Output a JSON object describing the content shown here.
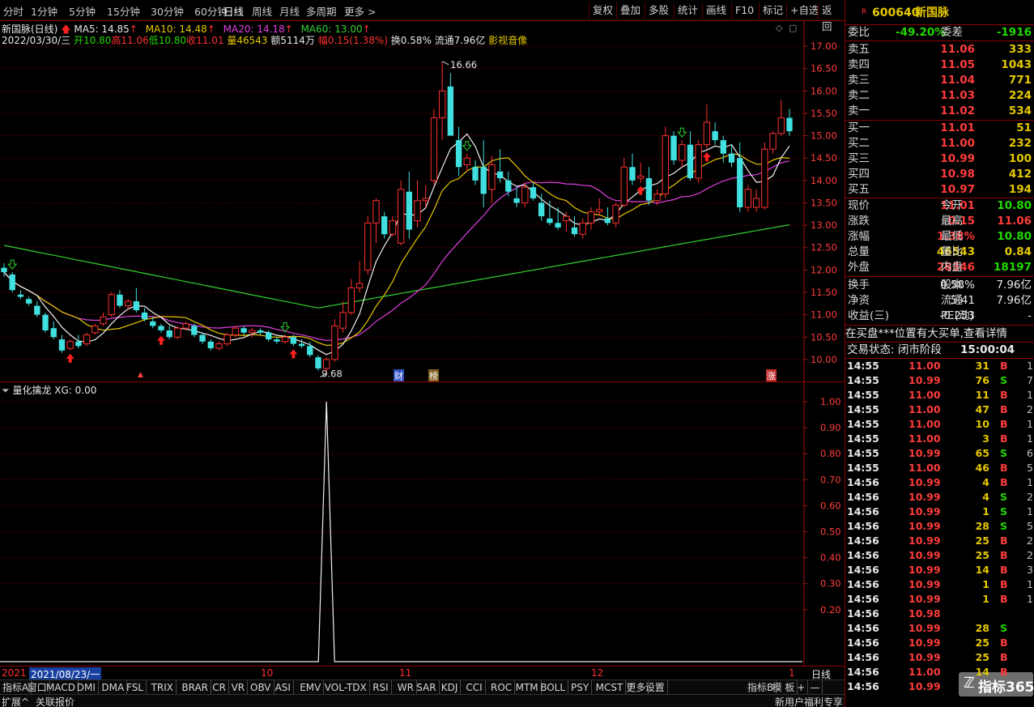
{
  "toolbar": {
    "periods": [
      "分时",
      "1分钟",
      "5分钟",
      "15分钟",
      "30分钟",
      "60分钟",
      "日线",
      "周线",
      "月线",
      "多周期",
      "更多"
    ],
    "more_arrow": ">",
    "actions": [
      "复权",
      "叠加",
      "多股",
      "统计",
      "画线",
      "F10",
      "标记",
      "+自选",
      "返回"
    ]
  },
  "info": {
    "title": "新国脉(日线)",
    "ma5": "MA5: 14.85",
    "ma10": "MA10: 14.48",
    "ma20": "MA20: 14.18",
    "ma60": "MA60: 13.00",
    "ma_arrow": "↑",
    "date": "2022/03/30/三",
    "open": "开10.80",
    "high": "高11.06",
    "low": "低10.80",
    "close": "收11.01",
    "volume": "量46543",
    "amount": "额5114万",
    "amp": "幅0.15(1.38%)",
    "turnover": "换0.58%",
    "float": "流通7.96亿",
    "sector": "影视音像"
  },
  "annotations": {
    "high_label": "16.66",
    "low_label": "9.68",
    "marker_cai": "财",
    "marker_bang": "榜",
    "marker_zhang": "涨"
  },
  "indicator": {
    "title": "量化擒龙 XG: 0.00"
  },
  "xaxis": {
    "start_label": "2021/08/23/一",
    "start_short": "2021",
    "labels": [
      "10",
      "11",
      "12",
      "1"
    ],
    "view": "日线"
  },
  "bottom_tabs": [
    "指标A",
    "窗口",
    "MACD",
    "DMI",
    "DMA",
    "FSL",
    "TRIX",
    "BRAR",
    "CR",
    "VR",
    "OBV",
    "ASI",
    "EMV",
    "VOL-TDX",
    "RSI",
    "WR",
    "SAR",
    "KDJ",
    "CCI",
    "ROC",
    "MTM",
    "BOLL",
    "PSY",
    "MCST",
    "更多",
    "设置",
    "指标B",
    "模 板",
    "+",
    "—"
  ],
  "status": {
    "expand": "扩展^",
    "report": "关联报价",
    "promo": "新用户福利专享"
  },
  "panel": {
    "r_badge": "R",
    "code": "600640",
    "name": "新国脉",
    "weibi_label": "委比",
    "weibi_value": "-49.20%",
    "weicha_label": "委差",
    "weicha_value": "-1916",
    "asks": [
      {
        "label": "卖五",
        "price": "11.06",
        "vol": "333"
      },
      {
        "label": "卖四",
        "price": "11.05",
        "vol": "1043"
      },
      {
        "label": "卖三",
        "price": "11.04",
        "vol": "771"
      },
      {
        "label": "卖二",
        "price": "11.03",
        "vol": "224"
      },
      {
        "label": "卖一",
        "price": "11.02",
        "vol": "534"
      }
    ],
    "bids": [
      {
        "label": "买一",
        "price": "11.01",
        "vol": "51"
      },
      {
        "label": "买二",
        "price": "11.00",
        "vol": "232"
      },
      {
        "label": "买三",
        "price": "10.99",
        "vol": "100"
      },
      {
        "label": "买四",
        "price": "10.98",
        "vol": "412"
      },
      {
        "label": "买五",
        "price": "10.97",
        "vol": "194"
      }
    ],
    "quote": [
      {
        "l1": "现价",
        "v1": "11.01",
        "c1": "red",
        "l2": "今开",
        "v2": "10.80",
        "c2": "green"
      },
      {
        "l1": "涨跌",
        "v1": "0.15",
        "c1": "red",
        "l2": "最高",
        "v2": "11.06",
        "c2": "red"
      },
      {
        "l1": "涨幅",
        "v1": "1.38%",
        "c1": "red",
        "l2": "最低",
        "v2": "10.80",
        "c2": "green"
      },
      {
        "l1": "总量",
        "v1": "46543",
        "c1": "yellow",
        "l2": "量比",
        "v2": "0.84",
        "c2": "yellow"
      },
      {
        "l1": "外盘",
        "v1": "28346",
        "c1": "red",
        "l2": "内盘",
        "v2": "18197",
        "c2": "green"
      }
    ],
    "fin": [
      {
        "l1": "换手",
        "v1": "0.58%",
        "l2": "股本",
        "v2": "7.96亿"
      },
      {
        "l1": "净资",
        "v1": "5.41",
        "l2": "流通",
        "v2": "7.96亿"
      },
      {
        "l1": "收益(三)",
        "v1": "-0.253",
        "l2": "PE(动)",
        "v2": "-"
      }
    ],
    "message": "在买盘***位置有大买单,查看详情",
    "trade_state": "交易状态: 闭市阶段",
    "trade_time": "15:00:04",
    "trades": [
      {
        "t": "14:55",
        "p": "11.00",
        "v": "31",
        "s": "B",
        "n": "1"
      },
      {
        "t": "14:55",
        "p": "10.99",
        "v": "76",
        "s": "S",
        "n": "7"
      },
      {
        "t": "14:55",
        "p": "11.00",
        "v": "11",
        "s": "B",
        "n": "1"
      },
      {
        "t": "14:55",
        "p": "11.00",
        "v": "47",
        "s": "B",
        "n": "2"
      },
      {
        "t": "14:55",
        "p": "11.00",
        "v": "10",
        "s": "B",
        "n": "1"
      },
      {
        "t": "14:55",
        "p": "11.00",
        "v": "3",
        "s": "B",
        "n": "1"
      },
      {
        "t": "14:55",
        "p": "10.99",
        "v": "65",
        "s": "S",
        "n": "6"
      },
      {
        "t": "14:55",
        "p": "11.00",
        "v": "46",
        "s": "B",
        "n": "5"
      },
      {
        "t": "14:56",
        "p": "10.99",
        "v": "4",
        "s": "B",
        "n": "1"
      },
      {
        "t": "14:56",
        "p": "10.99",
        "v": "4",
        "s": "S",
        "n": "2"
      },
      {
        "t": "14:56",
        "p": "10.99",
        "v": "1",
        "s": "S",
        "n": "1"
      },
      {
        "t": "14:56",
        "p": "10.99",
        "v": "28",
        "s": "S",
        "n": "5"
      },
      {
        "t": "14:56",
        "p": "10.99",
        "v": "25",
        "s": "B",
        "n": "2"
      },
      {
        "t": "14:56",
        "p": "10.99",
        "v": "25",
        "s": "B",
        "n": "2"
      },
      {
        "t": "14:56",
        "p": "10.99",
        "v": "14",
        "s": "B",
        "n": "3"
      },
      {
        "t": "14:56",
        "p": "10.99",
        "v": "1",
        "s": "B",
        "n": "1"
      },
      {
        "t": "14:56",
        "p": "10.99",
        "v": "1",
        "s": "B",
        "n": "1"
      },
      {
        "t": "14:56",
        "p": "10.98",
        "v": "",
        "s": "",
        "n": ""
      },
      {
        "t": "14:56",
        "p": "10.99",
        "v": "28",
        "s": "S",
        "n": ""
      },
      {
        "t": "14:56",
        "p": "10.99",
        "v": "25",
        "s": "B",
        "n": ""
      },
      {
        "t": "14:56",
        "p": "10.99",
        "v": "25",
        "s": "B",
        "n": ""
      },
      {
        "t": "14:56",
        "p": "11.00",
        "v": "14",
        "s": "B",
        "n": ""
      },
      {
        "t": "14:56",
        "p": "10.99",
        "v": "",
        "s": "",
        "n": ""
      },
      {
        "t": "14:56",
        "p": "10.99",
        "v": "",
        "s": "",
        "n": ""
      }
    ],
    "watermark": "指标365"
  },
  "chart_data": [
    {
      "type": "candlestick",
      "title": "新国脉(日线)",
      "ylim": [
        9.6,
        17.2
      ],
      "yticks": [
        10.0,
        10.5,
        11.0,
        11.5,
        12.0,
        12.5,
        13.0,
        13.5,
        14.0,
        14.5,
        15.0,
        15.5,
        16.0,
        16.5,
        17.0
      ],
      "candles": [
        [
          12.05,
          12.15,
          11.85,
          11.95
        ],
        [
          11.9,
          11.95,
          11.5,
          11.55
        ],
        [
          11.45,
          11.55,
          11.35,
          11.4
        ],
        [
          11.35,
          11.4,
          11.2,
          11.25
        ],
        [
          11.2,
          11.3,
          10.95,
          11.0
        ],
        [
          11.0,
          11.05,
          10.6,
          10.65
        ],
        [
          10.7,
          10.85,
          10.45,
          10.5
        ],
        [
          10.45,
          10.55,
          10.15,
          10.2
        ],
        [
          10.25,
          10.45,
          10.2,
          10.4
        ],
        [
          10.4,
          10.55,
          10.25,
          10.3
        ],
        [
          10.35,
          10.6,
          10.3,
          10.55
        ],
        [
          10.6,
          10.8,
          10.55,
          10.75
        ],
        [
          10.8,
          11.05,
          10.75,
          10.95
        ],
        [
          11.0,
          11.5,
          10.95,
          11.45
        ],
        [
          11.45,
          11.55,
          11.15,
          11.2
        ],
        [
          11.2,
          11.35,
          11.1,
          11.3
        ],
        [
          11.3,
          11.6,
          11.05,
          11.1
        ],
        [
          11.05,
          11.15,
          10.85,
          10.9
        ],
        [
          10.85,
          10.95,
          10.7,
          10.75
        ],
        [
          10.75,
          10.8,
          10.6,
          10.65
        ],
        [
          10.65,
          10.75,
          10.45,
          10.5
        ],
        [
          10.5,
          10.75,
          10.45,
          10.7
        ],
        [
          10.7,
          10.85,
          10.65,
          10.8
        ],
        [
          10.75,
          10.8,
          10.5,
          10.55
        ],
        [
          10.55,
          10.6,
          10.35,
          10.4
        ],
        [
          10.4,
          10.45,
          10.2,
          10.25
        ],
        [
          10.25,
          10.4,
          10.2,
          10.35
        ],
        [
          10.35,
          10.6,
          10.3,
          10.55
        ],
        [
          10.55,
          10.75,
          10.5,
          10.7
        ],
        [
          10.7,
          10.75,
          10.55,
          10.6
        ],
        [
          10.6,
          10.7,
          10.5,
          10.65
        ],
        [
          10.65,
          10.7,
          10.55,
          10.6
        ],
        [
          10.6,
          10.65,
          10.4,
          10.45
        ],
        [
          10.45,
          10.5,
          10.35,
          10.4
        ],
        [
          10.4,
          10.55,
          10.35,
          10.5
        ],
        [
          10.5,
          10.55,
          10.3,
          10.35
        ],
        [
          10.35,
          10.45,
          10.25,
          10.3
        ],
        [
          10.3,
          10.4,
          10.05,
          10.1
        ],
        [
          10.05,
          10.1,
          9.75,
          9.8
        ],
        [
          9.8,
          10.05,
          9.68,
          10.0
        ],
        [
          10.0,
          10.9,
          9.95,
          10.75
        ],
        [
          10.7,
          11.3,
          10.6,
          11.05
        ],
        [
          11.05,
          11.8,
          11.0,
          11.6
        ],
        [
          11.6,
          12.2,
          11.5,
          11.7
        ],
        [
          12.0,
          13.2,
          11.9,
          13.05
        ],
        [
          13.05,
          13.6,
          12.6,
          13.55
        ],
        [
          13.2,
          13.3,
          12.7,
          12.8
        ],
        [
          12.8,
          13.2,
          12.75,
          13.1
        ],
        [
          12.6,
          14.0,
          12.55,
          13.8
        ],
        [
          13.75,
          14.2,
          12.7,
          12.9
        ],
        [
          13.1,
          14.0,
          12.95,
          13.55
        ],
        [
          13.55,
          13.9,
          13.4,
          13.6
        ],
        [
          14.0,
          15.6,
          13.9,
          15.4
        ],
        [
          15.4,
          16.66,
          14.9,
          16.0
        ],
        [
          16.1,
          16.4,
          15.1,
          15.0
        ],
        [
          14.9,
          15.2,
          14.1,
          14.3
        ],
        [
          14.35,
          14.6,
          14.2,
          14.5
        ],
        [
          14.3,
          14.45,
          13.9,
          14.0
        ],
        [
          14.3,
          14.9,
          13.4,
          13.7
        ],
        [
          13.8,
          14.55,
          13.5,
          14.35
        ],
        [
          14.2,
          14.7,
          13.95,
          14.05
        ],
        [
          14.0,
          14.2,
          13.65,
          13.75
        ],
        [
          13.6,
          13.85,
          13.4,
          13.5
        ],
        [
          13.5,
          13.95,
          13.4,
          13.85
        ],
        [
          13.85,
          13.95,
          13.55,
          13.6
        ],
        [
          13.5,
          13.7,
          13.1,
          13.2
        ],
        [
          13.15,
          13.55,
          13.0,
          13.05
        ],
        [
          13.05,
          13.4,
          12.9,
          12.95
        ],
        [
          13.1,
          13.3,
          12.85,
          13.2
        ],
        [
          12.95,
          13.2,
          12.75,
          12.8
        ],
        [
          12.8,
          13.15,
          12.7,
          13.05
        ],
        [
          13.05,
          13.4,
          12.9,
          13.3
        ],
        [
          13.3,
          13.6,
          13.2,
          13.35
        ],
        [
          13.15,
          13.4,
          13.0,
          13.05
        ],
        [
          13.05,
          13.5,
          12.95,
          13.45
        ],
        [
          13.45,
          14.5,
          13.4,
          14.3
        ],
        [
          14.3,
          14.6,
          13.9,
          14.0
        ],
        [
          14.05,
          14.4,
          13.95,
          14.1
        ],
        [
          14.05,
          14.3,
          13.45,
          13.55
        ],
        [
          13.55,
          13.8,
          13.45,
          13.7
        ],
        [
          13.7,
          15.2,
          13.6,
          15.0
        ],
        [
          15.0,
          15.1,
          14.35,
          14.45
        ],
        [
          14.45,
          14.9,
          14.3,
          14.8
        ],
        [
          14.8,
          15.1,
          14.0,
          14.05
        ],
        [
          14.05,
          14.9,
          13.95,
          14.8
        ],
        [
          14.8,
          15.7,
          14.7,
          15.3
        ],
        [
          15.1,
          15.3,
          14.8,
          14.9
        ],
        [
          14.9,
          15.0,
          14.4,
          14.6
        ],
        [
          14.6,
          14.8,
          14.3,
          14.4
        ],
        [
          14.5,
          14.85,
          13.3,
          13.4
        ],
        [
          13.4,
          13.9,
          13.3,
          13.8
        ],
        [
          13.4,
          13.8,
          13.3,
          13.6
        ],
        [
          13.4,
          14.85,
          13.35,
          14.7
        ],
        [
          14.7,
          15.1,
          14.6,
          15.05
        ],
        [
          15.05,
          15.8,
          15.0,
          15.4
        ],
        [
          15.4,
          15.6,
          15.0,
          15.1
        ]
      ]
    },
    {
      "type": "line",
      "title": "量化擒龙 XG: 0.00",
      "ylim": [
        0,
        1.05
      ],
      "yticks": [
        0.2,
        0.3,
        0.4,
        0.5,
        0.6,
        0.7,
        0.8,
        0.9,
        1.0
      ],
      "spike_index": 39,
      "values_note": "XG equals 0 everywhere except 1 at the spike candle"
    }
  ]
}
